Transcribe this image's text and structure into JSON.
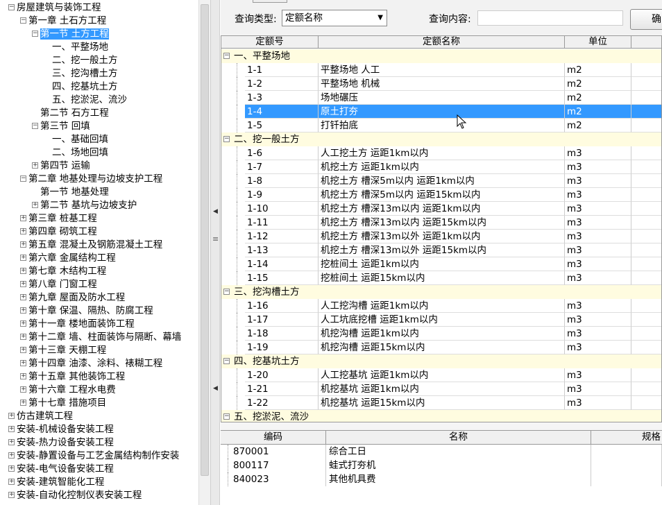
{
  "tree": [
    {
      "label": "房屋建筑与装饰工程",
      "toggle": "−",
      "indent": 0
    },
    {
      "label": "第一章 土石方工程",
      "toggle": "−",
      "indent": 1
    },
    {
      "label": "第一节 土方工程",
      "toggle": "−",
      "indent": 2,
      "selected": true
    },
    {
      "label": "一、平整场地",
      "toggle": "",
      "indent": 3
    },
    {
      "label": "二、挖一般土方",
      "toggle": "",
      "indent": 3
    },
    {
      "label": "三、挖沟槽土方",
      "toggle": "",
      "indent": 3
    },
    {
      "label": "四、挖基坑土方",
      "toggle": "",
      "indent": 3
    },
    {
      "label": "五、挖淤泥、流沙",
      "toggle": "",
      "indent": 3
    },
    {
      "label": "第二节 石方工程",
      "toggle": "",
      "indent": 2
    },
    {
      "label": "第三节 回填",
      "toggle": "−",
      "indent": 2
    },
    {
      "label": "一、基础回填",
      "toggle": "",
      "indent": 3
    },
    {
      "label": "二、场地回填",
      "toggle": "",
      "indent": 3
    },
    {
      "label": "第四节 运输",
      "toggle": "+",
      "indent": 2
    },
    {
      "label": "第二章 地基处理与边坡支护工程",
      "toggle": "−",
      "indent": 1
    },
    {
      "label": "第一节 地基处理",
      "toggle": "",
      "indent": 2
    },
    {
      "label": "第二节 基坑与边坡支护",
      "toggle": "+",
      "indent": 2
    },
    {
      "label": "第三章 桩基工程",
      "toggle": "+",
      "indent": 1
    },
    {
      "label": "第四章 砌筑工程",
      "toggle": "+",
      "indent": 1
    },
    {
      "label": "第五章 混凝土及钢筋混凝土工程",
      "toggle": "+",
      "indent": 1
    },
    {
      "label": "第六章 金属结构工程",
      "toggle": "+",
      "indent": 1
    },
    {
      "label": "第七章 木结构工程",
      "toggle": "+",
      "indent": 1
    },
    {
      "label": "第八章 门窗工程",
      "toggle": "+",
      "indent": 1
    },
    {
      "label": "第九章 屋面及防水工程",
      "toggle": "+",
      "indent": 1
    },
    {
      "label": "第十章 保温、隔热、防腐工程",
      "toggle": "+",
      "indent": 1
    },
    {
      "label": "第十一章 楼地面装饰工程",
      "toggle": "+",
      "indent": 1
    },
    {
      "label": "第十二章 墙、柱面装饰与隔断、幕墙",
      "toggle": "+",
      "indent": 1
    },
    {
      "label": "第十三章 天棚工程",
      "toggle": "+",
      "indent": 1
    },
    {
      "label": "第十四章 油漆、涂料、裱糊工程",
      "toggle": "+",
      "indent": 1
    },
    {
      "label": "第十五章 其他装饰工程",
      "toggle": "+",
      "indent": 1
    },
    {
      "label": "第十六章 工程水电费",
      "toggle": "+",
      "indent": 1
    },
    {
      "label": "第十七章 措施项目",
      "toggle": "+",
      "indent": 1
    },
    {
      "label": "仿古建筑工程",
      "toggle": "+",
      "indent": 0
    },
    {
      "label": "安装-机械设备安装工程",
      "toggle": "+",
      "indent": 0
    },
    {
      "label": "安装-热力设备安装工程",
      "toggle": "+",
      "indent": 0
    },
    {
      "label": "安装-静置设备与工艺金属结构制作安装",
      "toggle": "+",
      "indent": 0
    },
    {
      "label": "安装-电气设备安装工程",
      "toggle": "+",
      "indent": 0
    },
    {
      "label": "安装-建筑智能化工程",
      "toggle": "+",
      "indent": 0
    },
    {
      "label": "安装-自动化控制仪表安装工程",
      "toggle": "+",
      "indent": 0
    }
  ],
  "query": {
    "type_label": "查询类型:",
    "type_value": "定额名称",
    "content_label": "查询内容:",
    "content_value": "",
    "ok_label": "确"
  },
  "grid": {
    "headers": [
      "定额号",
      "定额名称",
      "单位",
      ""
    ],
    "rows": [
      {
        "group": "一、平整场地"
      },
      {
        "code": "1-1",
        "name": "平整场地 人工",
        "unit": "m2"
      },
      {
        "code": "1-2",
        "name": "平整场地 机械",
        "unit": "m2"
      },
      {
        "code": "1-3",
        "name": "场地碾压",
        "unit": "m2"
      },
      {
        "code": "1-4",
        "name": "原土打夯",
        "unit": "m2",
        "selected": true
      },
      {
        "code": "1-5",
        "name": "打钎拍底",
        "unit": "m2"
      },
      {
        "group": "二、挖一般土方"
      },
      {
        "code": "1-6",
        "name": "人工挖土方 运距1km以内",
        "unit": "m3"
      },
      {
        "code": "1-7",
        "name": "机挖土方 运距1km以内",
        "unit": "m3"
      },
      {
        "code": "1-8",
        "name": "机挖土方 槽深5m以内 运距1km以内",
        "unit": "m3"
      },
      {
        "code": "1-9",
        "name": "机挖土方 槽深5m以内 运距15km以内",
        "unit": "m3"
      },
      {
        "code": "1-10",
        "name": "机挖土方 槽深13m以内 运距1km以内",
        "unit": "m3"
      },
      {
        "code": "1-11",
        "name": "机挖土方 槽深13m以内 运距15km以内",
        "unit": "m3"
      },
      {
        "code": "1-12",
        "name": "机挖土方 槽深13m以外 运距1km以内",
        "unit": "m3"
      },
      {
        "code": "1-13",
        "name": "机挖土方 槽深13m以外 运距15km以内",
        "unit": "m3"
      },
      {
        "code": "1-14",
        "name": "挖桩间土 运距1km以内",
        "unit": "m3"
      },
      {
        "code": "1-15",
        "name": "挖桩间土 运距15km以内",
        "unit": "m3"
      },
      {
        "group": "三、挖沟槽土方"
      },
      {
        "code": "1-16",
        "name": "人工挖沟槽 运距1km以内",
        "unit": "m3"
      },
      {
        "code": "1-17",
        "name": "人工坑底挖槽 运距1km以内",
        "unit": "m3"
      },
      {
        "code": "1-18",
        "name": "机挖沟槽 运距1km以内",
        "unit": "m3"
      },
      {
        "code": "1-19",
        "name": "机挖沟槽 运距15km以内",
        "unit": "m3"
      },
      {
        "group": "四、挖基坑土方"
      },
      {
        "code": "1-20",
        "name": "人工挖基坑 运距1km以内",
        "unit": "m3"
      },
      {
        "code": "1-21",
        "name": "机挖基坑 运距1km以内",
        "unit": "m3"
      },
      {
        "code": "1-22",
        "name": "机挖基坑 运距15km以内",
        "unit": "m3"
      },
      {
        "group": "五、挖淤泥、流沙"
      }
    ]
  },
  "resources": {
    "headers": [
      "编码",
      "名称",
      "规格"
    ],
    "rows": [
      {
        "code": "870001",
        "name": "综合工日"
      },
      {
        "code": "800117",
        "name": "蛙式打夯机"
      },
      {
        "code": "840023",
        "name": "其他机具费"
      }
    ]
  },
  "icons": {
    "collapse": "minus-box-icon",
    "expand": "plus-box-icon",
    "dropdown": "chevron-down-icon"
  }
}
